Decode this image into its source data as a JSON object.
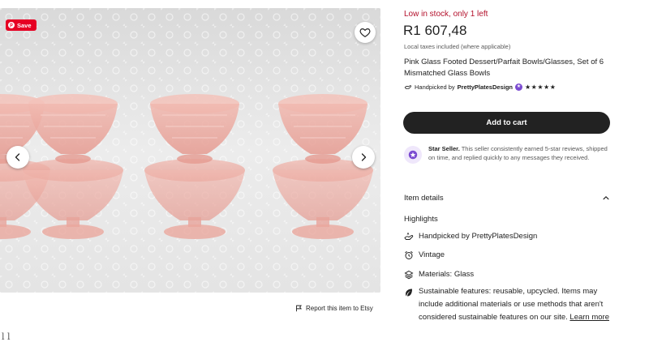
{
  "gallery": {
    "save_label": "Save",
    "pin_glyph": "p",
    "favorite_icon": "heart-icon",
    "prev_icon": "chevron-left-icon",
    "next_icon": "chevron-right-icon",
    "report_label": "Report this item to Etsy"
  },
  "listing": {
    "stock_status": "Low in stock, only 1 left",
    "price": "R1 607,48",
    "taxes_note": "Local taxes included (where applicable)",
    "title": "Pink Glass Footed Dessert/Parfait Bowls/Glasses, Set of 6 Mismatched Glass Bowls",
    "handpicked_prefix": "Handpicked by",
    "shop_name": "PrettyPlatesDesign",
    "rating_stars": "★★★★★",
    "rating_value": 5
  },
  "actions": {
    "add_to_cart_label": "Add to cart"
  },
  "star_seller": {
    "label": "Star Seller.",
    "text": " This seller consistently earned 5-star reviews, shipped on time, and replied quickly to any messages they received."
  },
  "item_details": {
    "header": "Item details",
    "highlights_label": "Highlights",
    "handpicked_prefix": "Handpicked by ",
    "shop_name": "PrettyPlatesDesign",
    "vintage": "Vintage",
    "materials": "Materials: Glass",
    "sustainable": "Sustainable features: reusable, upcycled. Items may include additional materials or use methods that aren't considered sustainable features on our site. ",
    "learn_more": "Learn more"
  },
  "footer_fragment": "l    l",
  "colors": {
    "stock_red": "#b3102b",
    "cart_button": "#222222",
    "save_badge": "#e60023",
    "star_badge": "#7b4bd1",
    "glass_pink": "#e9a9a0"
  }
}
